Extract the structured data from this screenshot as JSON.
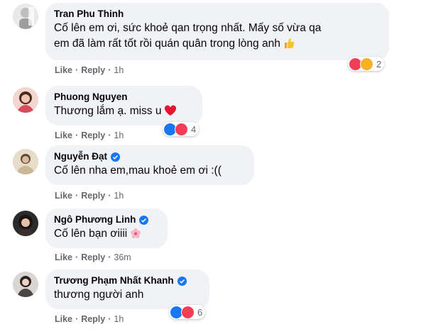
{
  "comments": [
    {
      "name": "Tran Phu Thinh",
      "text_line1": "Cố lên em ơi, sức khoẻ qan trọng nhất. Mấy số vừa qa",
      "text_line2": "em đã làm rất tốt rồi quán quân trong lòng anh",
      "emoji": "thumbs-up-emoji",
      "like": "Like",
      "reply": "Reply",
      "time": "1h",
      "reactions": [
        "love",
        "haha"
      ],
      "reaction_count": "2",
      "verified": false
    },
    {
      "name": "Phuong Nguyen",
      "text_line1": "Thương lắm ạ. miss u",
      "emoji": "red-heart-emoji",
      "like": "Like",
      "reply": "Reply",
      "time": "1h",
      "reactions": [
        "like",
        "love"
      ],
      "reaction_count": "4",
      "verified": false
    },
    {
      "name": "Nguyễn Đạt",
      "text_line1": "Cố lên nha em,mau khoẻ em ơi :((",
      "like": "Like",
      "reply": "Reply",
      "time": "1h",
      "verified": true
    },
    {
      "name": "Ngô Phương Linh",
      "text_line1": "Cố lên bạn ơiiii",
      "emoji": "cherry-blossom-emoji",
      "like": "Like",
      "reply": "Reply",
      "time": "36m",
      "verified": true
    },
    {
      "name": "Trương Phạm Nhất Khanh",
      "text_line1": "thương người anh",
      "like": "Like",
      "reply": "Reply",
      "time": "1h",
      "reactions": [
        "like",
        "love"
      ],
      "reaction_count": "6",
      "verified": true
    }
  ],
  "colors": {
    "bubble": "#f0f2f5",
    "link": "#65676b",
    "like_blue": "#1877f2",
    "love_red": "#f33e58",
    "haha_yellow": "#f7b125"
  }
}
